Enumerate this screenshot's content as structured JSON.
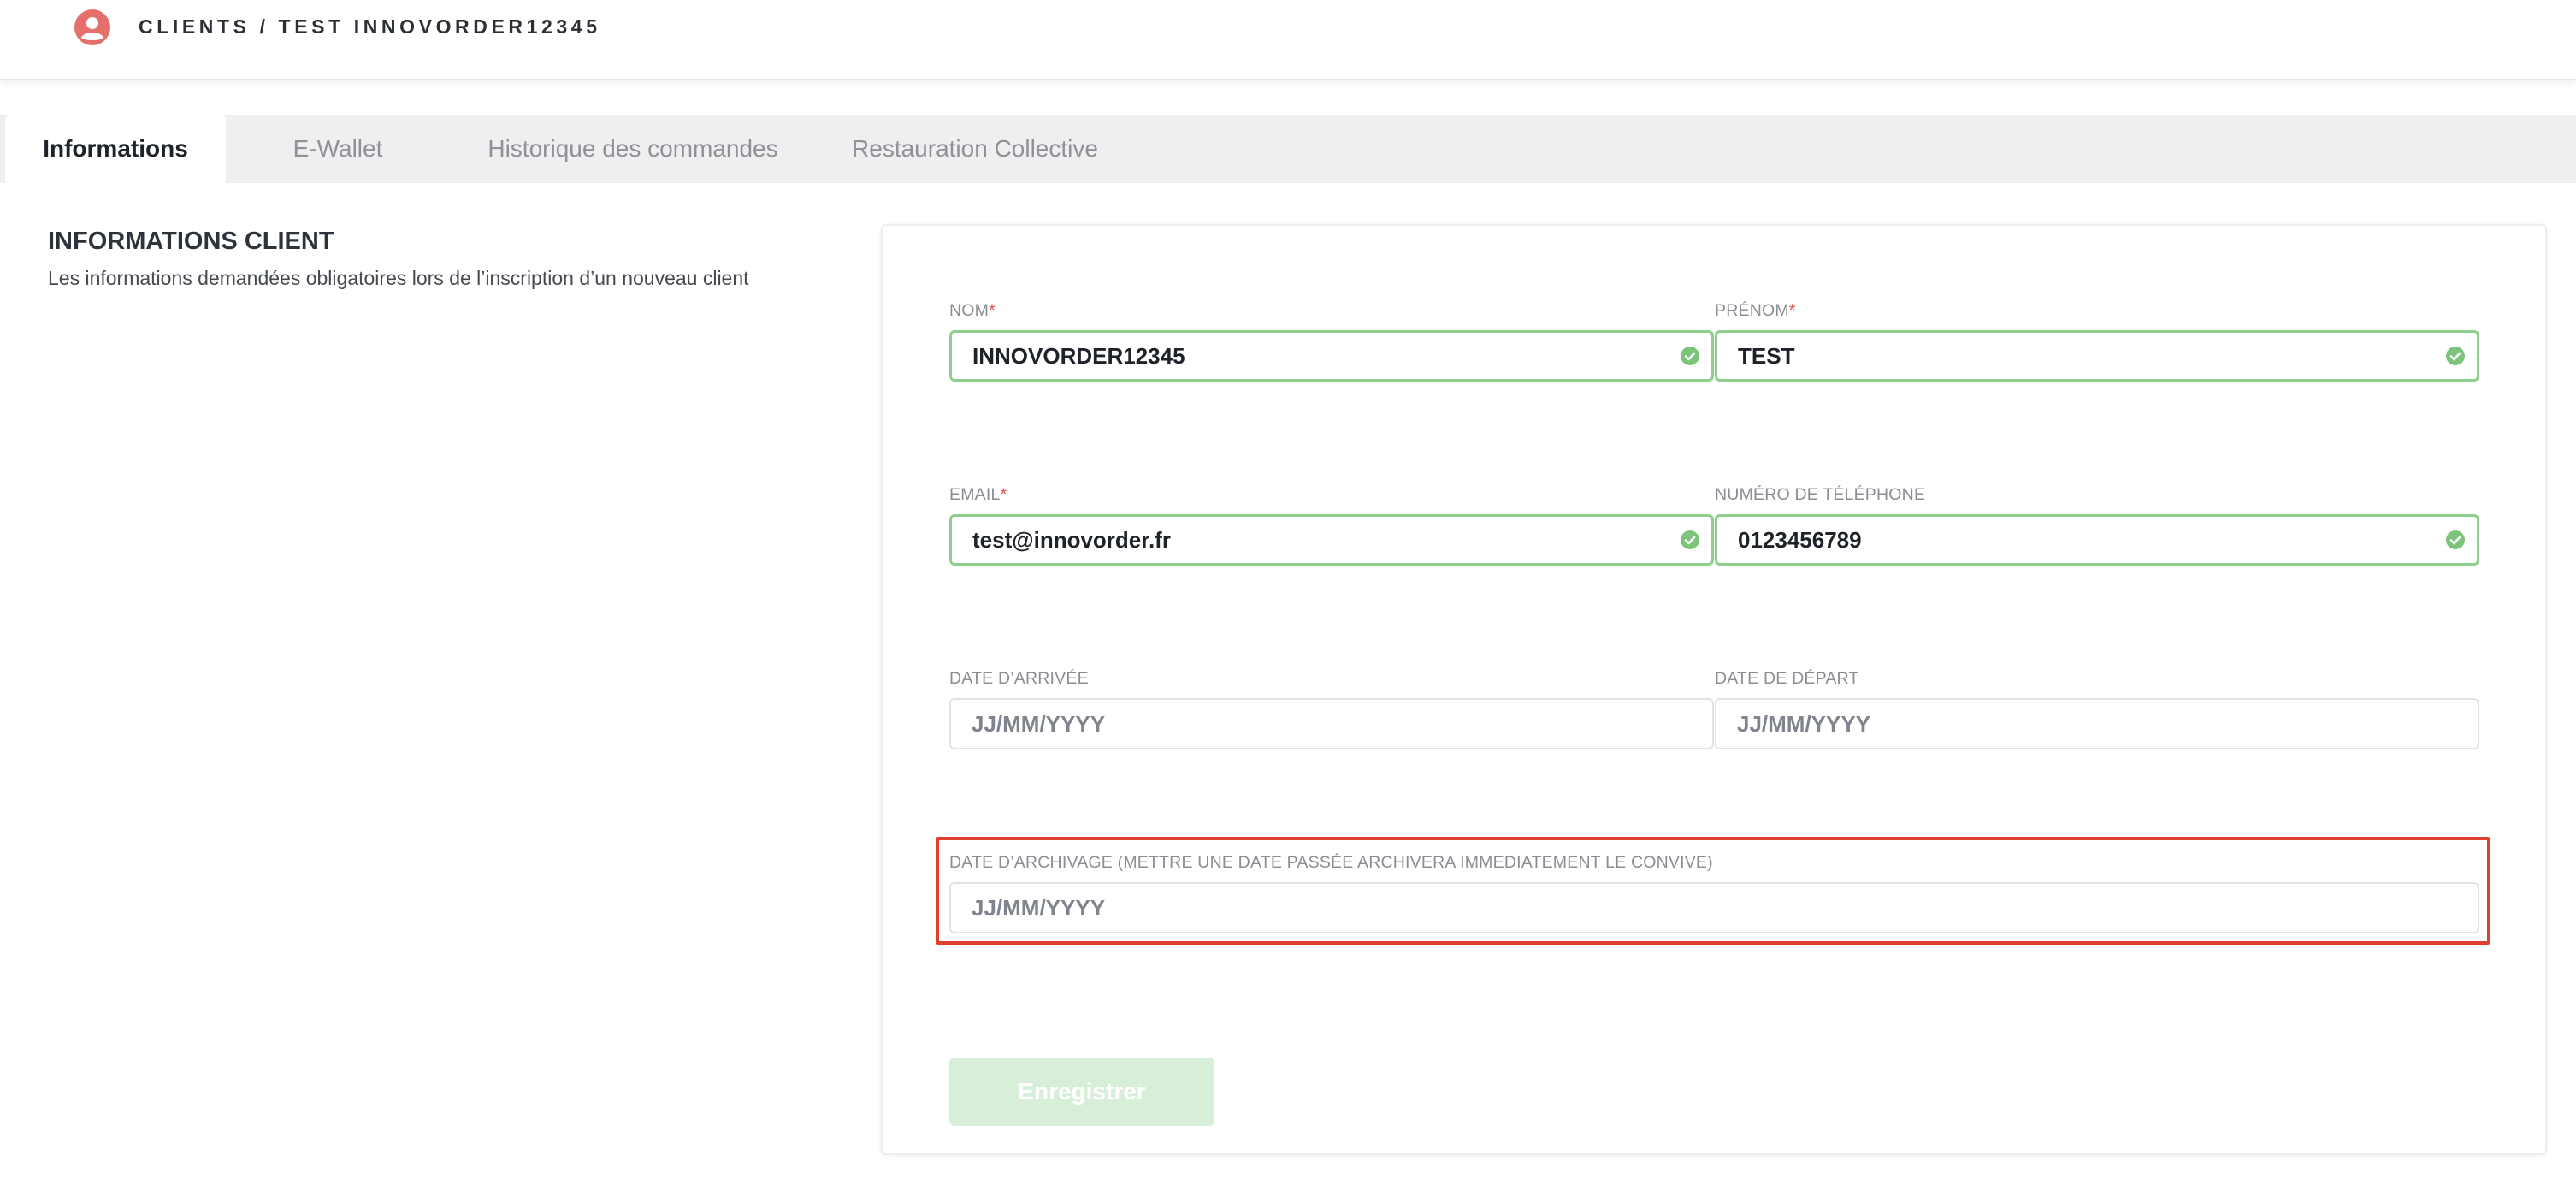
{
  "header": {
    "breadcrumb": "CLIENTS / TEST INNOVORDER12345",
    "avatar_icon": "user-circle-icon",
    "accent": "#e5706b"
  },
  "tabs": [
    {
      "label": "Informations",
      "active": true
    },
    {
      "label": "E-Wallet",
      "active": false
    },
    {
      "label": "Historique des commandes",
      "active": false
    },
    {
      "label": "Restauration Collective",
      "active": false
    }
  ],
  "section": {
    "title": "INFORMATIONS CLIENT",
    "description": "Les informations demandées obligatoires lors de l’inscription d’un nouveau client"
  },
  "form": {
    "nom": {
      "label": "NOM",
      "required": "*",
      "value": "INNOVORDER12345",
      "valid": true
    },
    "prenom": {
      "label": "PRÉNOM",
      "required": "*",
      "value": "TEST",
      "valid": true
    },
    "email": {
      "label": "EMAIL",
      "required": "*",
      "value": "test@innovorder.fr",
      "valid": true
    },
    "telephone": {
      "label": "NUMÉRO DE TÉLÉPHONE",
      "value": "0123456789",
      "valid": true
    },
    "date_arrivee": {
      "label": "DATE D’ARRIVÉE",
      "placeholder": "JJ/MM/YYYY",
      "value": ""
    },
    "date_depart": {
      "label": "DATE DE DÉPART",
      "placeholder": "JJ/MM/YYYY",
      "value": ""
    },
    "date_archivage": {
      "label": "DATE D’ARCHIVAGE (METTRE UNE DATE PASSÉE ARCHIVERA IMMEDIATEMENT LE CONVIVE)",
      "placeholder": "JJ/MM/YYYY",
      "value": ""
    },
    "save_label": "Enregistrer"
  },
  "colors": {
    "valid_border": "#8fd08f",
    "check": "#7cc47c",
    "highlight": "#e0412f",
    "save_button": "#d7efd9"
  }
}
